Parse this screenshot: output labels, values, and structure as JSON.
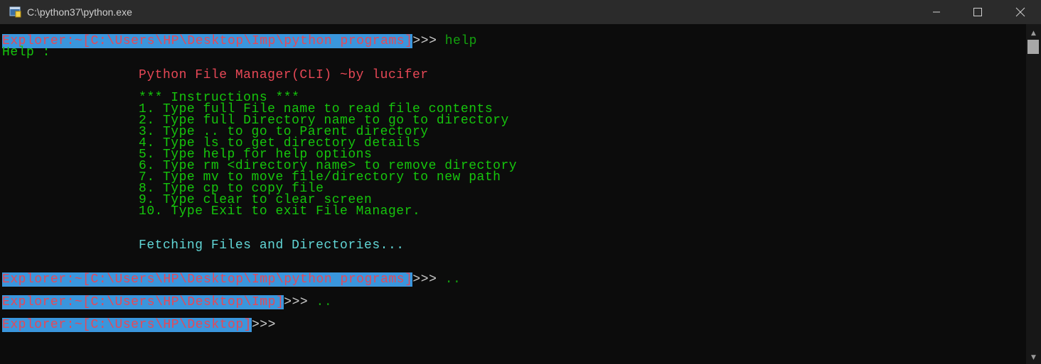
{
  "window": {
    "title": "C:\\python37\\python.exe"
  },
  "console": {
    "prompt1": "Explorer:~[C:\\Users\\HP\\Desktop\\Imp\\python programs]",
    "arrows": ">>>",
    "cmd1": " help",
    "help_label": "Help :",
    "app_title": "Python File Manager(CLI) ~by lucifer",
    "instructions_header": "*** Instructions ***",
    "instructions": [
      "1. Type full File name to read file contents",
      "2. Type full Directory name to go to directory",
      "3. Type .. to go to Parent directory",
      "4. Type ls to get directory details",
      "5. Type help for help options",
      "6. Type rm <directory name> to remove directory",
      "7. Type mv to move file/directory to new path",
      "8. Type cp to copy file",
      "9. Type clear to clear screen",
      "10. Type Exit to exit File Manager."
    ],
    "fetching": "Fetching Files and Directories...",
    "prompt2": "Explorer:~[C:\\Users\\HP\\Desktop\\Imp\\python programs]",
    "cmd2": " ..",
    "prompt3": "Explorer:~[C:\\Users\\HP\\Desktop\\Imp]",
    "cmd3": " ..",
    "prompt4": "Explorer:~[C:\\Users\\HP\\Desktop]"
  },
  "colors": {
    "prompt_bg": "#3a96dd",
    "prompt_fg": "#e74856",
    "help_green": "#16c60c",
    "cyan": "#61d6d6"
  }
}
